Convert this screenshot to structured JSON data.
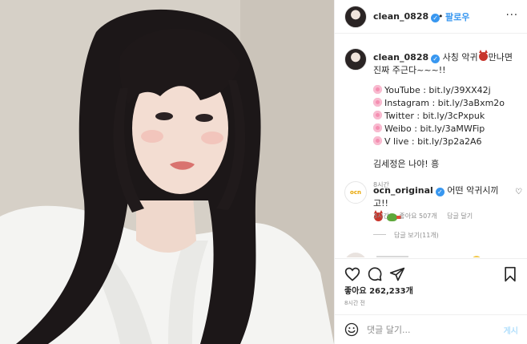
{
  "header": {
    "username": "clean_0828",
    "separator": "•",
    "follow_label": "팔로우",
    "more_label": "···"
  },
  "caption": {
    "username": "clean_0828",
    "text_1": " 사칭 악귀",
    "text_2": "만나면 진짜 주근다~~~!!",
    "links": [
      {
        "text": "YouTube : bit.ly/39XX42j"
      },
      {
        "text": "Instagram : bit.ly/3aBxm2o"
      },
      {
        "text": "Twitter : bit.ly/3cPxpuk"
      },
      {
        "text": "Weibo : bit.ly/3aMWFip"
      },
      {
        "text": "V live : bit.ly/3p2a2A6"
      }
    ],
    "signature": "김세정은 나야! 흥",
    "time": "8시간"
  },
  "comment": {
    "avatar_label": "ocn",
    "username": "ocn_original",
    "text": " 어떤 악귀시끼고!!",
    "time": "3시간",
    "likes": "좋아요 507개",
    "reply_label": "답글 달기",
    "view_replies": "답글 보기(11개)"
  },
  "post": {
    "likes": "좋아요 262,233개",
    "time": "8시간 전"
  },
  "add_comment": {
    "placeholder": "댓글 달기...",
    "post_label": "게시"
  },
  "colors": {
    "accent": "#3897f0",
    "text": "#262626",
    "muted": "#8e8e8e",
    "border": "#efefef"
  },
  "icons": [
    "more-icon",
    "verified-icon",
    "devil-emoji",
    "cherry-blossom-emoji",
    "frog-emoji",
    "heart-icon",
    "comment-icon",
    "share-icon",
    "bookmark-icon",
    "smile-icon"
  ]
}
